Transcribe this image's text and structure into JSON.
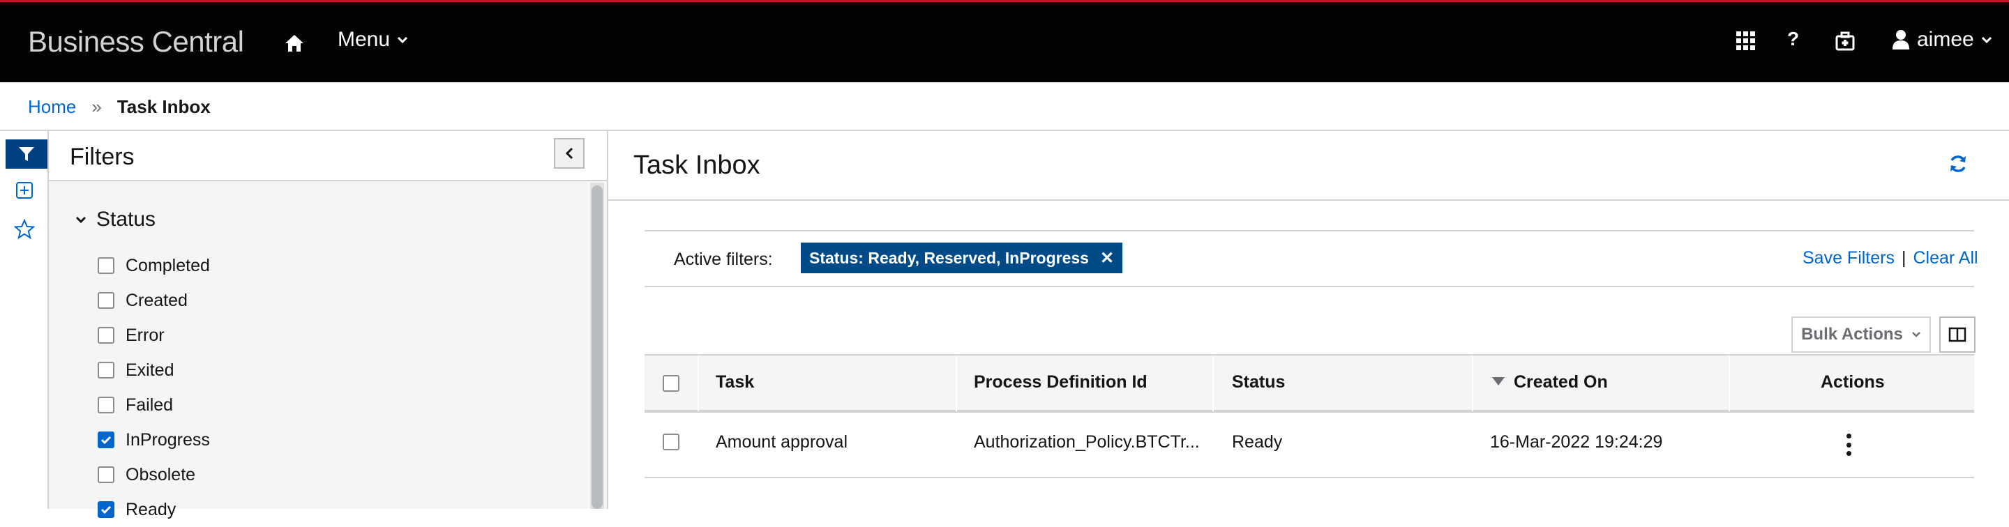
{
  "header": {
    "brand": "Business Central",
    "menu_label": "Menu",
    "help_label": "?",
    "user_label": "aimee"
  },
  "breadcrumb": {
    "home": "Home",
    "separator": "»",
    "current": "Task Inbox"
  },
  "filters": {
    "title": "Filters",
    "group_title": "Status",
    "items": [
      {
        "label": "Completed",
        "checked": false
      },
      {
        "label": "Created",
        "checked": false
      },
      {
        "label": "Error",
        "checked": false
      },
      {
        "label": "Exited",
        "checked": false
      },
      {
        "label": "Failed",
        "checked": false
      },
      {
        "label": "InProgress",
        "checked": true
      },
      {
        "label": "Obsolete",
        "checked": false
      },
      {
        "label": "Ready",
        "checked": true
      }
    ]
  },
  "main": {
    "title": "Task Inbox",
    "active_filters_label": "Active filters:",
    "active_chip": "Status: Ready, Reserved, InProgress",
    "chip_close": "✕",
    "save_filters": "Save Filters",
    "pipe": "|",
    "clear_all": "Clear All",
    "bulk_actions": "Bulk Actions"
  },
  "table": {
    "columns": [
      "Task",
      "Process Definition Id",
      "Status",
      "Created On",
      "Actions"
    ],
    "rows": [
      {
        "task": "Amount approval",
        "process_definition_id": "Authorization_Policy.BTCTr...",
        "status": "Ready",
        "created_on": "16-Mar-2022 19:24:29"
      }
    ]
  },
  "colors": {
    "topbar": "#030303",
    "accent_red": "#c8102e",
    "link_blue": "#0066cc",
    "chip_blue": "#004b87",
    "rail_active": "#004080"
  },
  "icons": [
    "home-icon",
    "chevron-down-icon",
    "apps-grid-icon",
    "help-icon",
    "briefcase-icon",
    "user-icon",
    "filter-icon",
    "add-square-icon",
    "star-icon",
    "chevron-left-icon",
    "refresh-icon",
    "sort-down-icon",
    "columns-icon",
    "kebab-icon"
  ]
}
